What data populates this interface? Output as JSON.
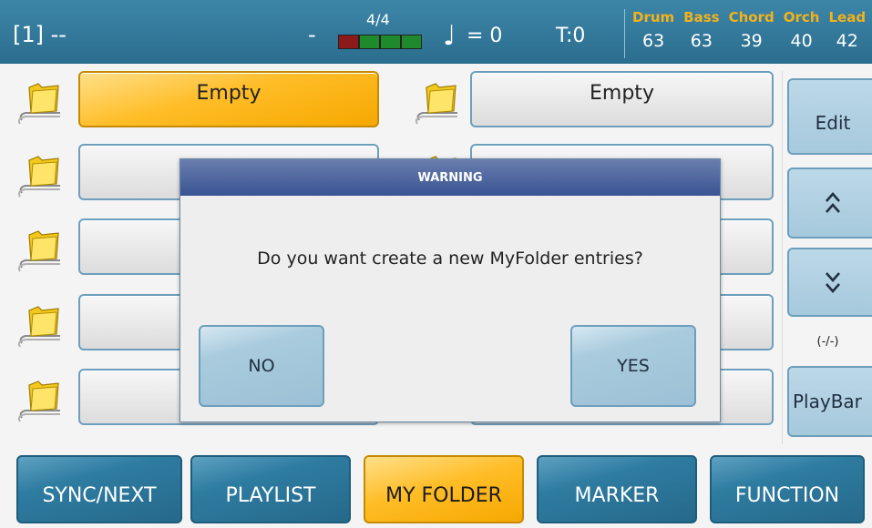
{
  "status_bar": {
    "song_slot": "[1] --",
    "dash": "-",
    "time_signature": "4/4",
    "tempo": "= 0",
    "transpose": "T:0",
    "parts": [
      {
        "name": "Drum",
        "value": "63"
      },
      {
        "name": "Bass",
        "value": "63"
      },
      {
        "name": "Chord",
        "value": "39"
      },
      {
        "name": "Orch",
        "value": "40"
      },
      {
        "name": "Lead",
        "value": "42"
      }
    ]
  },
  "folders": {
    "left": [
      {
        "label": "Empty",
        "active": true
      },
      {
        "label": "",
        "active": false
      },
      {
        "label": "",
        "active": false
      },
      {
        "label": "",
        "active": false
      },
      {
        "label": "",
        "active": false
      }
    ],
    "right": [
      {
        "label": "Empty",
        "active": false
      },
      {
        "label": "",
        "active": false
      },
      {
        "label": "",
        "active": false
      },
      {
        "label": "",
        "active": false
      },
      {
        "label": "",
        "active": false
      }
    ]
  },
  "side_panel": {
    "edit_label": "Edit",
    "up_label": "^^",
    "down_label": "vv",
    "page_indicator": "(-/-)",
    "playbar_label": "PlayBar"
  },
  "tabs": [
    {
      "label": "SYNC/NEXT",
      "active": false
    },
    {
      "label": "PLAYLIST",
      "active": false
    },
    {
      "label": "MY FOLDER",
      "active": true
    },
    {
      "label": "MARKER",
      "active": false
    },
    {
      "label": "FUNCTION",
      "active": false
    }
  ],
  "dialog": {
    "title": "WARNING",
    "message": "Do you want create a new MyFolder entries?",
    "no_label": "NO",
    "yes_label": "YES"
  },
  "colors": {
    "accent_active": "#ffbd27",
    "topbar": "#2b6d8e",
    "tab_blue": "#2e7ca1"
  }
}
